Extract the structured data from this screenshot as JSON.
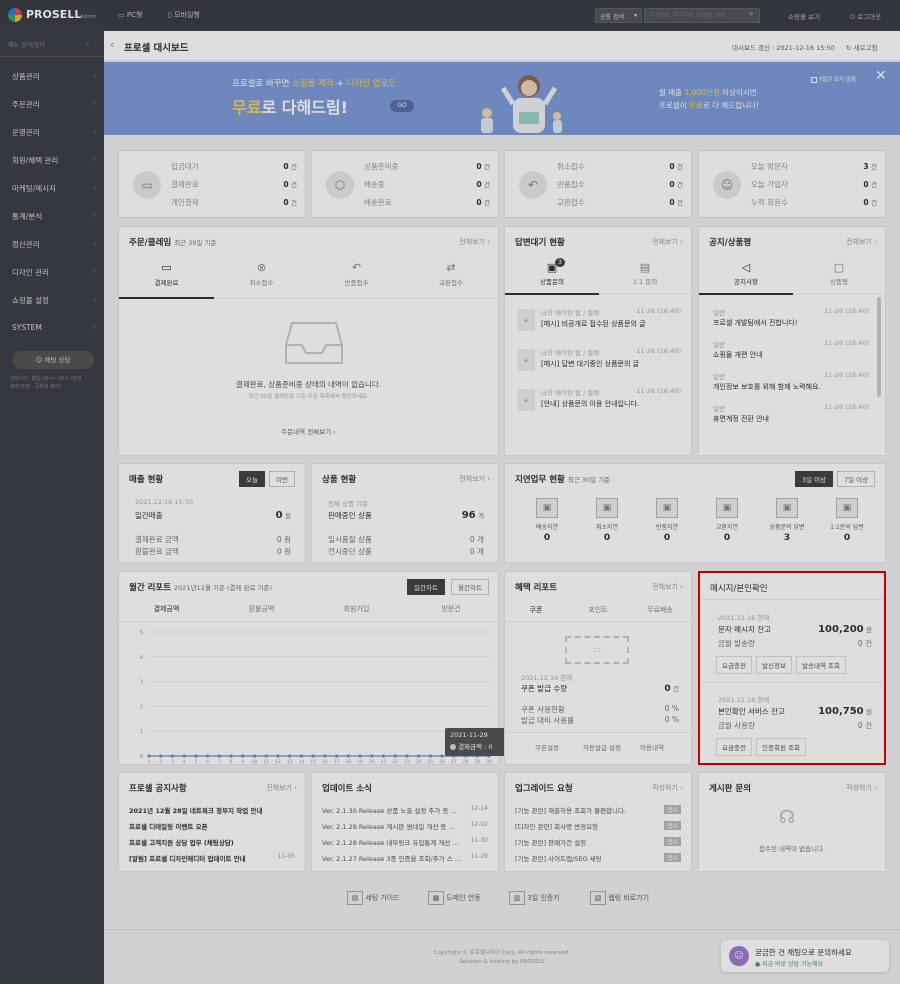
{
  "topbar": {
    "logo": "PROSELL",
    "logo_sub": "Admin",
    "pc": "PC형",
    "mobile": "모바일형",
    "select_value": "공통 검색",
    "search_placeholder": "주문번호, 주문자명, 회원명, 상품",
    "shop_link": "쇼핑몰 보기",
    "logout": "로그아웃"
  },
  "sidebar": {
    "filter": "메뉴 검색/필터",
    "items": [
      "상품관리",
      "주문관리",
      "운영관리",
      "회원/혜택 관리",
      "마케팅/메시지",
      "통계/분석",
      "정산관리",
      "디자인 관리",
      "쇼핑몰 설정",
      "SYSTEM"
    ],
    "chat_button": "채팅 상담",
    "notice_lines": [
      "상담시간: 평일 09시~18시 (점심",
      "휴무/주말 · 공휴일 휴무)"
    ]
  },
  "header": {
    "back": "‹",
    "title": "프로셀 대시보드",
    "update_label": "대시보드 갱신 : 2021-12-16 15:50",
    "refresh": "새로고침"
  },
  "banner": {
    "line1_pre": "프로셀로 바꾸면",
    "line1_em1": "쇼핑몰 제작",
    "line1_mid": "+",
    "line1_em2": "디자인 업로드",
    "line2_em": "무료",
    "line2_rest": "로 다해드림!",
    "go": "GO",
    "right1_pre": "월 매출",
    "right1_em": "1,000만원",
    "right1_rest": "이상이시면",
    "right2_pre": "프로셀이",
    "right2_em": "무료",
    "right2_rest": "로 다 해드립니다!",
    "check": "7일간 보지 않음",
    "close": "✕",
    "accent": "#f4d35e",
    "bg": "#7f9bd8"
  },
  "stats": [
    {
      "icon": "card-icon",
      "rows": [
        [
          "입금대기",
          "0",
          "건"
        ],
        [
          "결제완료",
          "0",
          "건"
        ],
        [
          "개인결제",
          "0",
          "건"
        ]
      ]
    },
    {
      "icon": "box-icon",
      "rows": [
        [
          "상품준비중",
          "0",
          "건"
        ],
        [
          "배송중",
          "0",
          "건"
        ],
        [
          "배송완료",
          "0",
          "건"
        ]
      ]
    },
    {
      "icon": "return-icon",
      "rows": [
        [
          "취소접수",
          "0",
          "건"
        ],
        [
          "반품접수",
          "0",
          "건"
        ],
        [
          "교환접수",
          "0",
          "건"
        ]
      ]
    },
    {
      "icon": "user-icon",
      "rows": [
        [
          "오늘 방문자",
          "3",
          "건"
        ],
        [
          "오늘 가입자",
          "0",
          "건"
        ],
        [
          "누적 회원수",
          "0",
          "건"
        ]
      ]
    }
  ],
  "order_claim": {
    "title": "주문/클레임",
    "sub": "최근 30일 기준",
    "more": "전체보기 ›",
    "tabs": [
      "결제완료",
      "취소접수",
      "반품접수",
      "교환접수"
    ],
    "empty_msg": "결제완료, 상품준비중 상태의 내역이 없습니다.",
    "empty_sub": "최근 30일 결제완료 기준 주문 목록에서 확인하세요.",
    "all_link": "주문내역 전체보기 ›"
  },
  "answer": {
    "title": "답변대기 현황",
    "more": "전체보기 ›",
    "tabs": [
      "상품문의",
      "1:1 문의"
    ],
    "badge": "3",
    "items": [
      {
        "meta": "나의 메이킹 탑 / 블랙",
        "date": "11-26 (16:40)",
        "text": "[메시] 비공개로 접수된 상품문의 글"
      },
      {
        "meta": "나의 메이킹 탑 / 블랙",
        "date": "11-26 (16:40)",
        "text": "[메시] 답변 대기중인 상품문의 글"
      },
      {
        "meta": "나의 메이킹 탑 / 블랙",
        "date": "11-26 (16:40)",
        "text": "[안내] 상품문의 이용 안내입니다."
      }
    ]
  },
  "notice_box": {
    "title": "공지/상품평",
    "more": "전체보기 ›",
    "tabs": [
      "공지사항",
      "상품평"
    ],
    "items": [
      {
        "cat": "일반",
        "date": "11-26 (16:40)",
        "text": "프로셀 개발팀에서 전합니다!"
      },
      {
        "cat": "일반",
        "date": "11-26 (16:40)",
        "text": "쇼핑몰 개편 안내"
      },
      {
        "cat": "일반",
        "date": "11-26 (16:40)",
        "text": "개인정보 보호를 위해 함께 노력해요."
      },
      {
        "cat": "일반",
        "date": "11-26 (16:40)",
        "text": "휴면계정 전환 안내"
      }
    ]
  },
  "sales": {
    "title": "매출 현황",
    "tabs": [
      "오늘",
      "이번"
    ],
    "date": "2021.12.16 15:50",
    "label": "일간매출",
    "value": "0",
    "unit": "원",
    "rows": [
      [
        "결제완료 금액",
        "0",
        "원"
      ],
      [
        "환불완료 금액",
        "0",
        "원"
      ]
    ]
  },
  "products": {
    "title": "상품 현황",
    "more": "전체보기 ›",
    "sub": "전체 상품 기준",
    "rows": [
      [
        "판매중인 상품",
        "96",
        "개"
      ],
      [
        "일시품절 상품",
        "0",
        "개"
      ],
      [
        "전시중단 상품",
        "0",
        "개"
      ]
    ]
  },
  "delay": {
    "title": "지연업무 현황",
    "sub": "최근 30일 기준",
    "tabs": [
      "3일 이상",
      "7일 이상"
    ],
    "items": [
      [
        "배송지연",
        "0"
      ],
      [
        "취소지연",
        "0"
      ],
      [
        "반품지연",
        "0"
      ],
      [
        "교환지연",
        "0"
      ],
      [
        "상품문의 답변",
        "3"
      ],
      [
        "1:1문의 답변",
        "0"
      ]
    ]
  },
  "monthly": {
    "title": "월간 리포트",
    "sub": "2021년12월 기준 (결제 완료 기준)",
    "tabs": [
      "일간차트",
      "월간차트"
    ],
    "cols": [
      "결제금액",
      "환불금액",
      "회원가입",
      "방문건"
    ],
    "tooltip_date": "2021-11-29",
    "tooltip_label": "결제금액 : 0"
  },
  "chart_data": {
    "type": "line",
    "title": "",
    "x": [
      "1",
      "2",
      "3",
      "4",
      "5",
      "6",
      "7",
      "8",
      "9",
      "10",
      "11",
      "12",
      "13",
      "14",
      "15",
      "16",
      "17",
      "18",
      "19",
      "20",
      "21",
      "22",
      "23",
      "24",
      "25",
      "26",
      "27",
      "28",
      "29",
      "30"
    ],
    "series": [
      {
        "name": "결제금액",
        "values": [
          0,
          0,
          0,
          0,
          0,
          0,
          0,
          0,
          0,
          0,
          0,
          0,
          0,
          0,
          0,
          0,
          0,
          0,
          0,
          0,
          0,
          0,
          0,
          0,
          0,
          0,
          0,
          0,
          0,
          0
        ]
      }
    ],
    "ylim": [
      0,
      5
    ],
    "yticks": [
      "0",
      "1",
      "2",
      "3",
      "4",
      "5"
    ],
    "grid": true
  },
  "benefit": {
    "title": "혜택 리포트",
    "more": "전체보기 ›",
    "cols": [
      "쿠폰",
      "포인트",
      "무료배송"
    ],
    "date": "2021.12.16 현재",
    "label": "쿠폰 발급 수량",
    "value": "0",
    "unit": "건",
    "rows": [
      [
        "쿠폰 사용현황",
        "0",
        "%"
      ],
      [
        "발급 대비 사용률",
        "0",
        "%"
      ]
    ],
    "links": [
      "쿠폰설정",
      "자동발급 설정",
      "이용내역"
    ]
  },
  "message": {
    "title": "메시지/본인확인",
    "block1": {
      "date": "2021.12.16 현재",
      "label": "문자 메시지 잔고",
      "value": "100,200",
      "unit": "원",
      "sub_label": "금월 발송량",
      "sub_value": "0",
      "sub_unit": "건",
      "buttons": [
        "요금충전",
        "발신정보",
        "발송내역 조회"
      ]
    },
    "block2": {
      "date": "2021.12.16 현재",
      "label": "본인확인 서비스 잔고",
      "value": "100,750",
      "unit": "원",
      "sub_label": "금월 사용량",
      "sub_value": "0",
      "sub_unit": "건",
      "buttons": [
        "요금충전",
        "인증회원 조회"
      ]
    },
    "highlight": "#e00000"
  },
  "prosell_notice": {
    "title": "프로셀 공지사항",
    "more": "전체보기 ›",
    "items": [
      [
        "2021년 12월 28일 네트워크 정부지 작업 안내",
        ""
      ],
      [
        "프로셀 디테일링 이벤트 오픈",
        ""
      ],
      [
        "프로셀 고객지원 상담 업무 (채팅상담)",
        ""
      ],
      [
        "[알림] 프로셀 디자인에디터 업데이트 안내",
        "11-05"
      ]
    ]
  },
  "update": {
    "title": "업데이트 소식",
    "items": [
      [
        "Ver. 2.1.30 Release 상품 노출 설정 추가 등 ...",
        "12-14"
      ],
      [
        "Ver. 2.1.29 Release 게시판 썸네일 개선 등 ...",
        "12-02"
      ],
      [
        "Ver. 2.1.28 Release 내부링크 유입통계 개선 ...",
        "11-30"
      ],
      [
        "Ver. 2.1.27 Release 3중 인증을 조회/추가 스 ...",
        "11-29"
      ]
    ]
  },
  "upgrade": {
    "title": "업그레이드 요청",
    "more": "작성하기 ›",
    "items": [
      [
        "[기능 관련] 재출하용 조회가 불편합니다.",
        "접수"
      ],
      [
        "[디자인 관련] 회사명 변경요청",
        "접수"
      ],
      [
        "[기능 관련] 판매가건 설정",
        "접수"
      ],
      [
        "[기능 관련] 사이트맵/SEO 세팅",
        "접수"
      ]
    ]
  },
  "board": {
    "title": "게시판 문의",
    "more": "작성하기 ›",
    "empty": "접수된 내역이 없습니다."
  },
  "quick": [
    "세팅 가이드",
    "도메인 연동",
    "3일 인증키",
    "웹링 바로가기"
  ],
  "footer": {
    "line1": "Copyright © 프로셀디자이 Corp. All rights reserved.",
    "line2": "Solution & hosting by PROSELL"
  },
  "chatbot": {
    "line1": "궁금한 건 채팅으로 문의하세요",
    "line2": "● 지금 바로 상담 가능해요"
  }
}
